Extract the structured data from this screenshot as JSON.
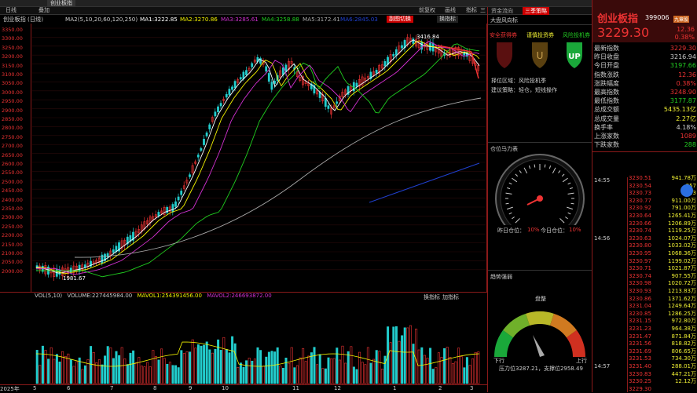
{
  "tabs": [
    "",
    "创业板指"
  ],
  "toolbar": {
    "left": [
      "日线",
      "叠加"
    ],
    "right": [
      "前复权",
      "画线",
      "指标",
      "三"
    ]
  },
  "info": {
    "title": "创业板指 (日线)",
    "ma_label": "MA2(5,10,20,60,120,250)",
    "ma1": "MA1:3222.85",
    "ma2": "MA2:3270.86",
    "ma3": "MA3:3285.61",
    "ma4": "MA4:3258.88",
    "ma5": "MA5:3172.41",
    "ma6": "MA6:2845.03"
  },
  "chart_buttons": [
    "副图切换",
    "换指标"
  ],
  "price_axis": [
    "3416.84",
    "3350.00",
    "3300.00",
    "3250.00",
    "3200.00",
    "3150.00",
    "3100.00",
    "3050.00",
    "3000.00",
    "2950.00",
    "2900.00",
    "2850.00",
    "2800.00",
    "2750.00",
    "2700.00",
    "2650.00",
    "2600.00",
    "2550.00",
    "2500.00",
    "2450.00",
    "2400.00",
    "2350.00",
    "2300.00",
    "2250.00",
    "2200.00",
    "2150.00",
    "2100.00",
    "2050.00",
    "2000.00",
    "1981.67"
  ],
  "annotations": {
    "high": "3416.84",
    "low": "1981.67"
  },
  "vol_info": {
    "label": "VOL(5,10)",
    "volume": "VOLUME:227445984.00",
    "mavol1": "MAVOL1:254391456.00",
    "mavol2": "MAVOL2:246693872.00"
  },
  "vol_buttons": [
    "换指标",
    "加指标"
  ],
  "dates": [
    "2025年",
    "5",
    "6",
    "7",
    "8",
    "9",
    "10",
    "11",
    "12",
    "1",
    "2",
    "3"
  ],
  "panel": {
    "tabs": [
      "资金流向",
      "三季策略"
    ],
    "section1": "大盘风向标",
    "wind": [
      {
        "label": "安全获得券"
      },
      {
        "label": "谨慎投资券"
      },
      {
        "label": "风险投机券"
      }
    ],
    "zone_label": "择位区域：风险投机季",
    "advice_label": "建议策略：轻仓，短线操作",
    "section2": "仓位马力表",
    "gauge1_left": "昨日仓位：",
    "gauge1_left_val": "10%",
    "gauge1_right": "今日仓位：",
    "gauge1_right_val": "10%",
    "section3": "趋势强弱",
    "gauge2_top": "盘整",
    "gauge2_left": "下行",
    "gauge2_right": "上行",
    "pressure": "压力位3287.21，支撑位2958.49"
  },
  "quote": {
    "name": "创业板指",
    "code": "399006",
    "badge": "九章股",
    "price": "3229.30",
    "change": "12.36",
    "pct": "0.38%",
    "rows": [
      {
        "k": "最新指数",
        "v": "3229.30",
        "c": "#e33"
      },
      {
        "k": "昨日收盘",
        "v": "3216.94",
        "c": "#ccc"
      },
      {
        "k": "今日开盘",
        "v": "3197.66",
        "c": "#2c2"
      },
      {
        "k": "指数涨跌",
        "v": "12.36",
        "c": "#e33"
      },
      {
        "k": "涨跌幅度",
        "v": "0.38%",
        "c": "#e33"
      },
      {
        "k": "最高指数",
        "v": "3248.90",
        "c": "#e33"
      },
      {
        "k": "最低指数",
        "v": "3177.87",
        "c": "#2c2"
      },
      {
        "k": "总成交额",
        "v": "5435.13亿",
        "c": "#ee3"
      },
      {
        "k": "总成交量",
        "v": "2.27亿",
        "c": "#ee3"
      },
      {
        "k": "换手率",
        "v": "4.18%",
        "c": "#ccc"
      },
      {
        "k": "上涨家数",
        "v": "1089",
        "c": "#e33"
      },
      {
        "k": "下跌家数",
        "v": "288",
        "c": "#2c2"
      }
    ],
    "ticks_time": [
      "14:55",
      "14:56",
      "14:57"
    ],
    "ticks": [
      {
        "p": "3230.51",
        "v": "941.78万"
      },
      {
        "p": "3230.54",
        "v": "857"
      },
      {
        "p": "3230.73",
        "v": "913"
      },
      {
        "p": "3230.77",
        "v": "911.00万"
      },
      {
        "p": "3230.92",
        "v": "791.00万"
      },
      {
        "p": "3230.64",
        "v": "1265.41万"
      },
      {
        "p": "3230.66",
        "v": "1206.89万"
      },
      {
        "p": "3230.74",
        "v": "1119.25万"
      },
      {
        "p": "3230.63",
        "v": "1024.07万"
      },
      {
        "p": "3230.80",
        "v": "1033.02万"
      },
      {
        "p": "3230.95",
        "v": "1068.36万"
      },
      {
        "p": "3230.97",
        "v": "1199.02万"
      },
      {
        "p": "3230.71",
        "v": "1021.87万"
      },
      {
        "p": "3230.74",
        "v": "907.55万"
      },
      {
        "p": "3230.98",
        "v": "1020.72万"
      },
      {
        "p": "3230.93",
        "v": "1213.83万"
      },
      {
        "p": "3230.86",
        "v": "1371.62万"
      },
      {
        "p": "3231.04",
        "v": "1249.64万"
      },
      {
        "p": "3230.85",
        "v": "1286.25万"
      },
      {
        "p": "3231.15",
        "v": "972.80万"
      },
      {
        "p": "3231.23",
        "v": "964.38万"
      },
      {
        "p": "3231.47",
        "v": "871.84万"
      },
      {
        "p": "3231.56",
        "v": "818.82万"
      },
      {
        "p": "3231.69",
        "v": "806.65万"
      },
      {
        "p": "3231.53",
        "v": "734.30万"
      },
      {
        "p": "3231.40",
        "v": "288.01万"
      },
      {
        "p": "3230.83",
        "v": "447.21万"
      },
      {
        "p": "3230.25",
        "v": "12.12万"
      },
      {
        "p": "3229.30",
        "v": ""
      }
    ]
  },
  "colors": {
    "up": "#e33",
    "down": "#2cc",
    "ma1": "#ffffff",
    "ma2": "#f5f500",
    "ma3": "#d030d0",
    "ma4": "#20d020",
    "ma5": "#aaaaaa",
    "ma6": "#2040d0"
  }
}
